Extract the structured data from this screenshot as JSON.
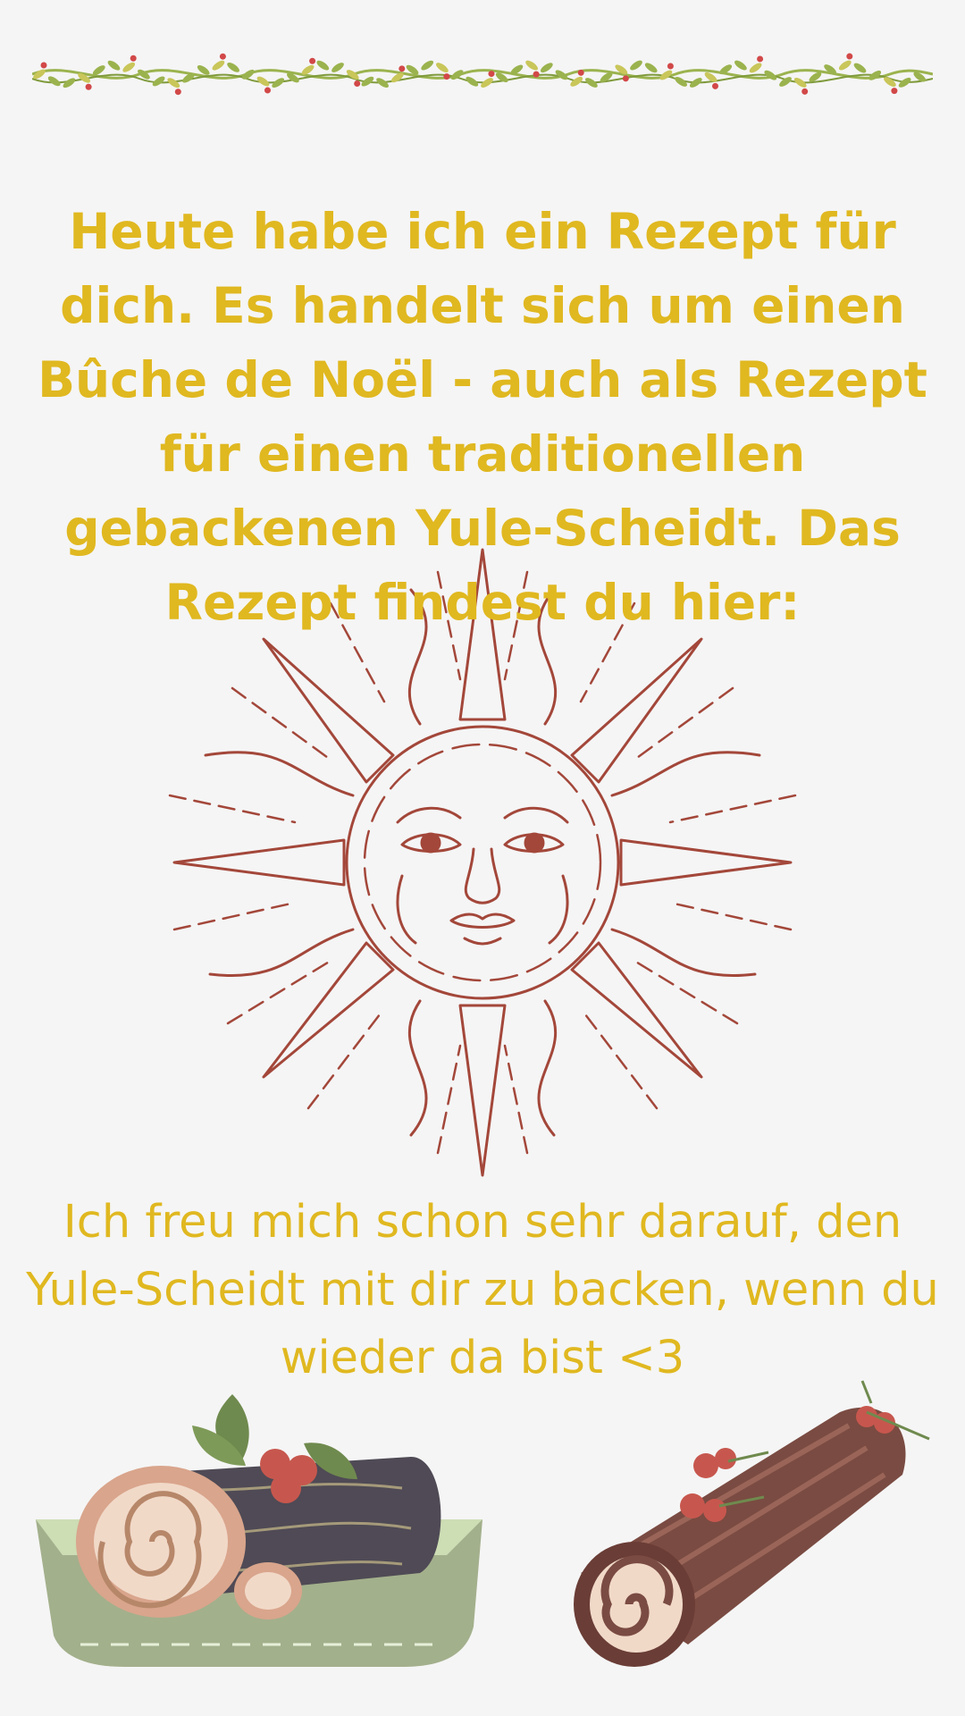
{
  "colors": {
    "background": "#f5f5f5",
    "text_gold": "#e0b820",
    "sun_line": "#a3473a",
    "garland_green": "#8fa84a",
    "berry_red": "#d24848"
  },
  "decorations": {
    "garland_icon": "holly-garland-icon",
    "sun_icon": "sun-face-icon",
    "cake_left_icon": "yule-log-plate-icon",
    "cake_right_icon": "chocolate-yule-log-icon"
  },
  "message": {
    "intro": "Heute habe ich ein Rezept für dich. Es handelt sich um einen Bûche de Noël - auch als Rezept für einen traditionellen gebackenen Yule-Scheidt. Das Rezept findest du hier:",
    "outro": "Ich freu mich schon sehr darauf, den Yule-Scheidt mit dir zu backen, wenn du wieder da bist <3"
  }
}
